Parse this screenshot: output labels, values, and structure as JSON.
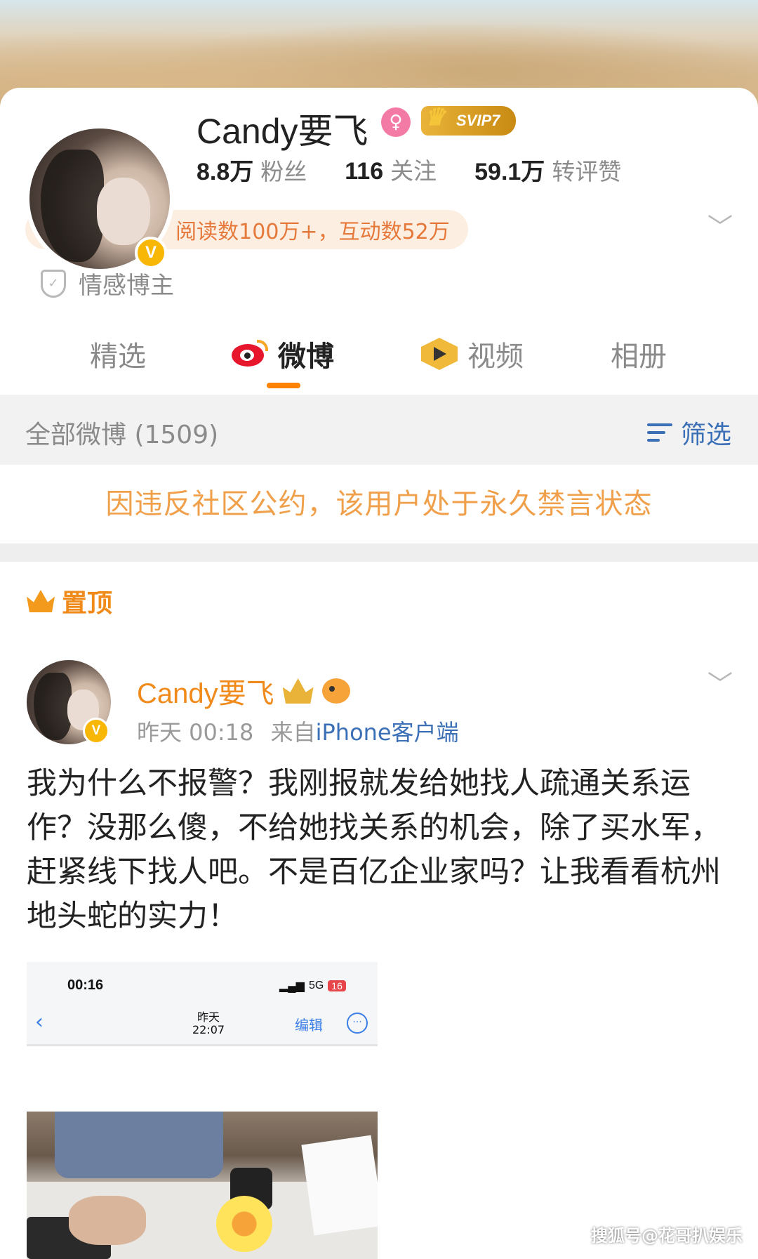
{
  "profile": {
    "nickname": "Candy要飞",
    "gender_icon": "female-icon",
    "vip_label": "SVIP7",
    "verified_badge": "V",
    "stats": [
      {
        "num": "8.8万",
        "label": "粉丝"
      },
      {
        "num": "116",
        "label": "关注"
      },
      {
        "num": "59.1万",
        "label": "转评赞"
      }
    ],
    "summary_pill": "昨日发博22，阅读数100万+，互动数52万",
    "tag": "情感博主"
  },
  "tabs": [
    {
      "label": "精选"
    },
    {
      "label": "微博",
      "active": true
    },
    {
      "label": "视频"
    },
    {
      "label": "相册"
    }
  ],
  "filter_bar": {
    "all_label": "全部微博 (1509)",
    "filter_label": "筛选"
  },
  "ban_notice": "因违反社区公约，该用户处于永久禁言状态",
  "pinned_label": "置顶",
  "post": {
    "nickname": "Candy要飞",
    "time": "昨天 00:18",
    "from_prefix": "来自",
    "source": "iPhone客户端",
    "text": "我为什么不报警？我刚报就发给她找人疏通关系运作？没那么傻，不给她找关系的机会，除了买水军，赶紧线下找人吧。不是百亿企业家吗？让我看看杭州地头蛇的实力！"
  },
  "screenshot": {
    "time": "00:16",
    "signal": "5G",
    "battery": "16",
    "date_line1": "昨天",
    "date_line2": "22:07",
    "edit": "编辑",
    "back": "‹",
    "more": "···"
  },
  "watermark": "搜狐号@花哥扒娱乐",
  "colors": {
    "accent_orange": "#ff8200",
    "pill_text": "#e5793b",
    "ban_text": "#f0a04b",
    "link_blue": "#3b6fb6",
    "verified_yellow": "#f8b704"
  }
}
